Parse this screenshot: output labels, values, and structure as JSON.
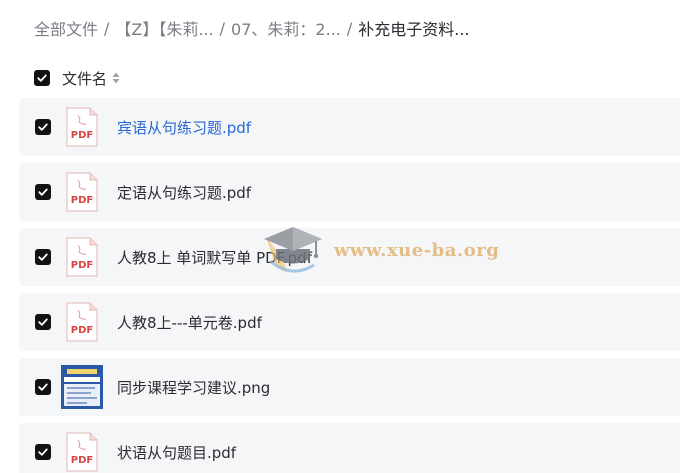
{
  "breadcrumb": {
    "items": [
      "全部文件",
      "【Z】【朱莉...",
      "07、朱莉：2...",
      "补充电子资料..."
    ],
    "separator": "/"
  },
  "list_header": {
    "column_title": "文件名"
  },
  "files": [
    {
      "name": "宾语从句练习题.pdf",
      "type": "pdf",
      "icon_label": "PDF",
      "highlighted": true
    },
    {
      "name": "定语从句练习题.pdf",
      "type": "pdf",
      "icon_label": "PDF"
    },
    {
      "name": "人教8上 单词默写单 PDF.pdf",
      "type": "pdf",
      "icon_label": "PDF"
    },
    {
      "name": "人教8上---单元卷.pdf",
      "type": "pdf",
      "icon_label": "PDF"
    },
    {
      "name": "同步课程学习建议.png",
      "type": "png"
    },
    {
      "name": "状语从句题目.pdf",
      "type": "pdf",
      "icon_label": "PDF"
    }
  ],
  "watermark": {
    "text": "www.xue-ba.org"
  },
  "colors": {
    "checkbox": "#111214",
    "row_background": "#f5f6f7",
    "link": "#2a67d6",
    "pdf_red": "#d64541",
    "watermark": "#e1b373"
  }
}
